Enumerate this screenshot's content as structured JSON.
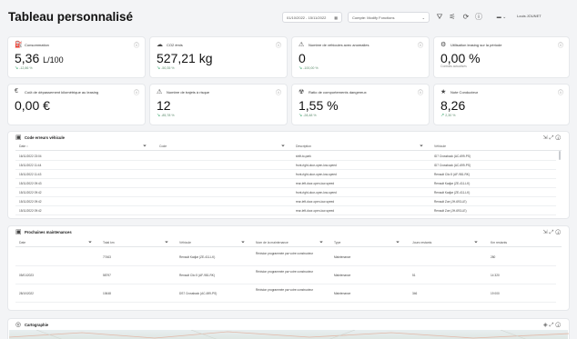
{
  "header": {
    "title": "Tableau personnalisé",
    "date_range": "01/10/2022 - 15/11/2022",
    "account": "Compte: Modify Fonctions",
    "user": "Louis JOUNET"
  },
  "kpis": [
    {
      "icon": "fuel-icon",
      "glyph": "⛽",
      "title": "Consommation",
      "value": "5,36",
      "unit": "L/100",
      "trend": "-12,86 %",
      "trend_dir": "down"
    },
    {
      "icon": "co2-icon",
      "glyph": "☁",
      "title": "CO2 émis",
      "value": "527,21 kg",
      "unit": "",
      "trend": "-50,35 %",
      "trend_dir": "down"
    },
    {
      "icon": "vehicle-anomaly-icon",
      "glyph": "⚠",
      "title": "Nombre de véhicules avec anomalies",
      "value": "0",
      "unit": "",
      "trend": "-100,00 %",
      "trend_dir": "down"
    },
    {
      "icon": "leasing-icon",
      "glyph": "⚙",
      "title": "Utilisation leasing sur la période",
      "value": "0,00 %",
      "unit": "",
      "sub": "Contrats actualisés",
      "trend_dir": "none"
    },
    {
      "icon": "cost-icon",
      "glyph": "€",
      "title": "Coût de dépassement kilométrique au leasing",
      "value": "0,00 €",
      "unit": "",
      "trend_dir": "none"
    },
    {
      "icon": "risk-trip-icon",
      "glyph": "⚠",
      "title": "Nombre de trajets à risque",
      "value": "12",
      "unit": "",
      "trend": "-85,78 %",
      "trend_dir": "down"
    },
    {
      "icon": "danger-behavior-icon",
      "glyph": "☢",
      "title": "Ratio de comportements dangereux",
      "value": "1,55 %",
      "unit": "",
      "trend": "-28,48 %",
      "trend_dir": "down"
    },
    {
      "icon": "driver-score-icon",
      "glyph": "★",
      "title": "Note Conducteur",
      "value": "8,26",
      "unit": "",
      "trend": "2,30 %",
      "trend_dir": "up"
    }
  ],
  "errors_table": {
    "title": "Code erreurs véhicule",
    "columns": [
      "Date ↕",
      "Code",
      "Description",
      "Véhicule"
    ],
    "rows": [
      [
        "16/11/2022 23:04",
        "",
        "shift-to-park",
        "ID7 Crossback (AC-699-PS)"
      ],
      [
        "15/11/2022 11:44",
        "",
        "front-right-door-open-low-speed",
        "ID7 Crossback (AC-699-PS)"
      ],
      [
        "15/11/2022 11:43",
        "",
        "front-right-door-open-low-speed",
        "Renault Clio 5 (AF-981-RK)"
      ],
      [
        "15/11/2022 09:43",
        "",
        "rear-left-door-open-low-speed",
        "Renault Kadjar (ZE-411-LK)"
      ],
      [
        "15/11/2022 09:42",
        "",
        "front-right-door-open-low-speed",
        "Renault Kadjar (ZE-411-LK)"
      ],
      [
        "15/11/2022 09:42",
        "",
        "rear-left-door-open-low-speed",
        "Renault Zoe (JH-693-LE)"
      ],
      [
        "15/11/2022 09:42",
        "",
        "rear-left-door-open-low-speed",
        "Renault Zoe (JH-693-LE)"
      ]
    ]
  },
  "maint_table": {
    "title": "Prochaines maintenances",
    "columns": [
      "Date",
      "Total km",
      "Véhicule",
      "Nom de la maintenance",
      "Type",
      "Jours restants",
      "Km restants"
    ],
    "rows": [
      [
        "",
        "77463",
        "Renault Kadjar (ZE-411-LK)",
        "Révision programmée par votre constructeur",
        "Maintenance",
        "",
        "280"
      ],
      [
        "05/01/2023",
        "58797",
        "Renault Clio 5 (AF-981-RK)",
        "Révision programmée par votre constructeur",
        "Maintenance",
        "51",
        "14 320"
      ],
      [
        "28/10/2022",
        "10648",
        "DS7 Crossback (AC-699-PS)",
        "Révision programmée par votre constructeur",
        "Maintenance",
        "346",
        "19 000"
      ]
    ]
  },
  "map": {
    "title": "Cartographie"
  },
  "colors": {
    "trend_good": "#3aa76d",
    "card_bg": "#ffffff",
    "page_bg": "#f3f4f6"
  }
}
